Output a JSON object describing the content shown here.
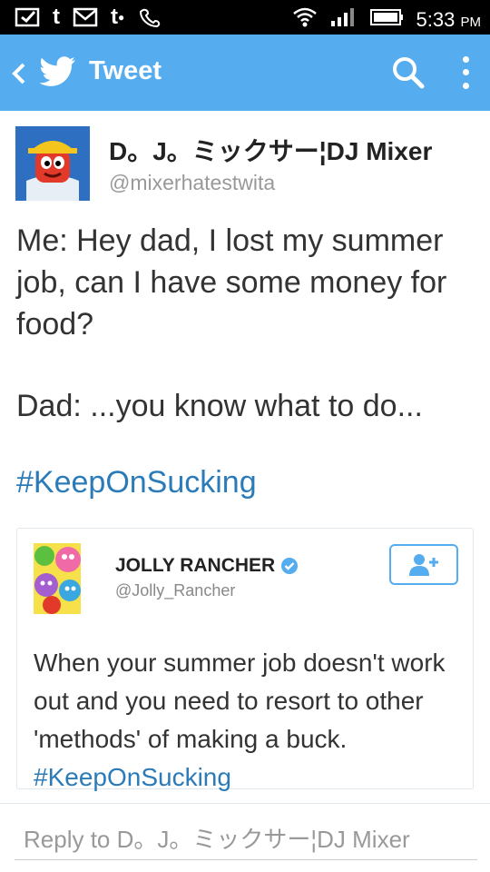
{
  "status_bar": {
    "left_icons": [
      "notification-check-icon",
      "tumblr-icon",
      "gmail-icon",
      "tumblr-notification-icon",
      "voicemail-icon"
    ],
    "right_icons": [
      "wifi-icon",
      "signal-icon",
      "battery-icon"
    ],
    "time": "5:33",
    "ampm": "PM"
  },
  "app_bar": {
    "title": "Tweet",
    "color": "#55acee"
  },
  "tweet": {
    "author_name": "D。J。ミックサー¦DJ Mixer",
    "author_handle": "@mixerhatestwita",
    "text_line1": "Me: Hey dad, I lost my summer job, can I have some money for food?",
    "text_line2": "Dad: ...you know what to do...",
    "hashtag": "#KeepOnSucking"
  },
  "quoted_tweet": {
    "name": "JOLLY RANCHER",
    "handle": "@Jolly_Rancher",
    "text": "When your summer job doesn't work out and you need to resort to other 'methods' of making a buck.",
    "hashtag": "#KeepOnSucking"
  },
  "reply": {
    "placeholder": "Reply to D。J。ミックサー¦DJ Mixer"
  },
  "colors": {
    "accent": "#55acee",
    "link": "#2b7bb9",
    "text": "#333333",
    "muted": "#999999"
  }
}
